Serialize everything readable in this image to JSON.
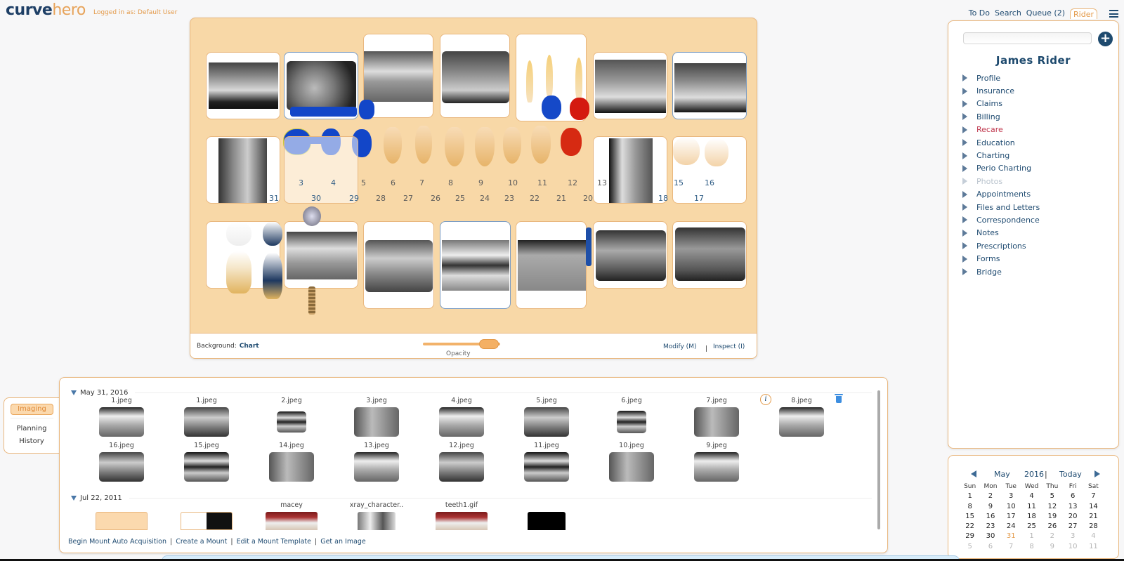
{
  "header": {
    "logo_part1": "curve",
    "logo_part2": "hero",
    "logged_in": "Logged in as: Default User",
    "nav": [
      "To Do",
      "Search",
      "Queue (2)",
      "Rider"
    ],
    "active_nav": "Rider",
    "menu_icon": "hamburger-icon"
  },
  "patient_panel": {
    "search_value": "",
    "add_icon": "plus-circle-icon",
    "patient_name": "James Rider",
    "menu": [
      {
        "label": "Profile",
        "state": "normal"
      },
      {
        "label": "Insurance",
        "state": "normal"
      },
      {
        "label": "Claims",
        "state": "normal"
      },
      {
        "label": "Billing",
        "state": "normal"
      },
      {
        "label": "Recare",
        "state": "alert"
      },
      {
        "label": "Education",
        "state": "normal"
      },
      {
        "label": "Charting",
        "state": "normal"
      },
      {
        "label": "Perio Charting",
        "state": "normal"
      },
      {
        "label": "Photos",
        "state": "disabled"
      },
      {
        "label": "Appointments",
        "state": "normal"
      },
      {
        "label": "Files and Letters",
        "state": "normal"
      },
      {
        "label": "Correspondence",
        "state": "normal"
      },
      {
        "label": "Notes",
        "state": "normal"
      },
      {
        "label": "Prescriptions",
        "state": "normal"
      },
      {
        "label": "Forms",
        "state": "normal"
      },
      {
        "label": "Bridge",
        "state": "normal"
      }
    ]
  },
  "calendar": {
    "month": "May",
    "year": "2016",
    "separator": "|",
    "today_label": "Today",
    "weekdays": [
      "Sun",
      "Mon",
      "Tue",
      "Wed",
      "Thu",
      "Fri",
      "Sat"
    ],
    "days": [
      [
        "1",
        "2",
        "3",
        "4",
        "5",
        "6",
        "7"
      ],
      [
        "8",
        "9",
        "10",
        "11",
        "12",
        "13",
        "14"
      ],
      [
        "15",
        "16",
        "17",
        "18",
        "19",
        "20",
        "21"
      ],
      [
        "22",
        "23",
        "24",
        "25",
        "26",
        "27",
        "28"
      ],
      [
        "29",
        "30",
        "31",
        "1",
        "2",
        "3",
        "4"
      ],
      [
        "5",
        "6",
        "7",
        "8",
        "9",
        "10",
        "11"
      ]
    ],
    "selected_day": "31",
    "colors": {
      "today": "#e39a4a",
      "other_month": "#b5b5b5"
    }
  },
  "tooth_chart": {
    "upper_numbers": [
      "3",
      "4",
      "5",
      "6",
      "7",
      "8",
      "9",
      "10",
      "11",
      "12",
      "13",
      "15",
      "16"
    ],
    "lower_numbers": [
      "31",
      "30",
      "29",
      "28",
      "27",
      "26",
      "25",
      "24",
      "23",
      "22",
      "21",
      "20",
      "18",
      "17"
    ],
    "background_label": "Background:",
    "background_value": "Chart",
    "opacity_label": "Opacity",
    "opacity_value": 0.85,
    "modify_label": "Modify (M)",
    "inspect_label": "Inspect (I)",
    "colors": {
      "bg": "#f8d8a7",
      "crown_blue": "#1246c8",
      "crown_red": "#d2190f",
      "tooth": "#f0c988"
    }
  },
  "side_tabs": [
    "Imaging",
    "Planning",
    "History"
  ],
  "active_side_tab": "Imaging",
  "imaging": {
    "groups": [
      {
        "date": "May 31, 2016",
        "rows": [
          [
            "1.jpeg",
            "1.jpeg",
            "2.jpeg",
            "3.jpeg",
            "4.jpeg",
            "5.jpeg",
            "6.jpeg",
            "7.jpeg",
            "8.jpeg"
          ],
          [
            "16.jpeg",
            "15.jpeg",
            "14.jpeg",
            "13.jpeg",
            "12.jpeg",
            "11.jpeg",
            "10.jpeg",
            "9.jpeg"
          ]
        ]
      },
      {
        "date": "Jul 22, 2011",
        "rows": [
          [
            "",
            "",
            "macey",
            "xray_character..",
            "teeth1.gif",
            ""
          ]
        ]
      }
    ],
    "info_icon": "info-icon",
    "delete_icon": "trash-icon",
    "actions": [
      "Begin Mount Auto Acquisition",
      "Create a Mount",
      "Edit a Mount Template",
      "Get an Image"
    ]
  }
}
